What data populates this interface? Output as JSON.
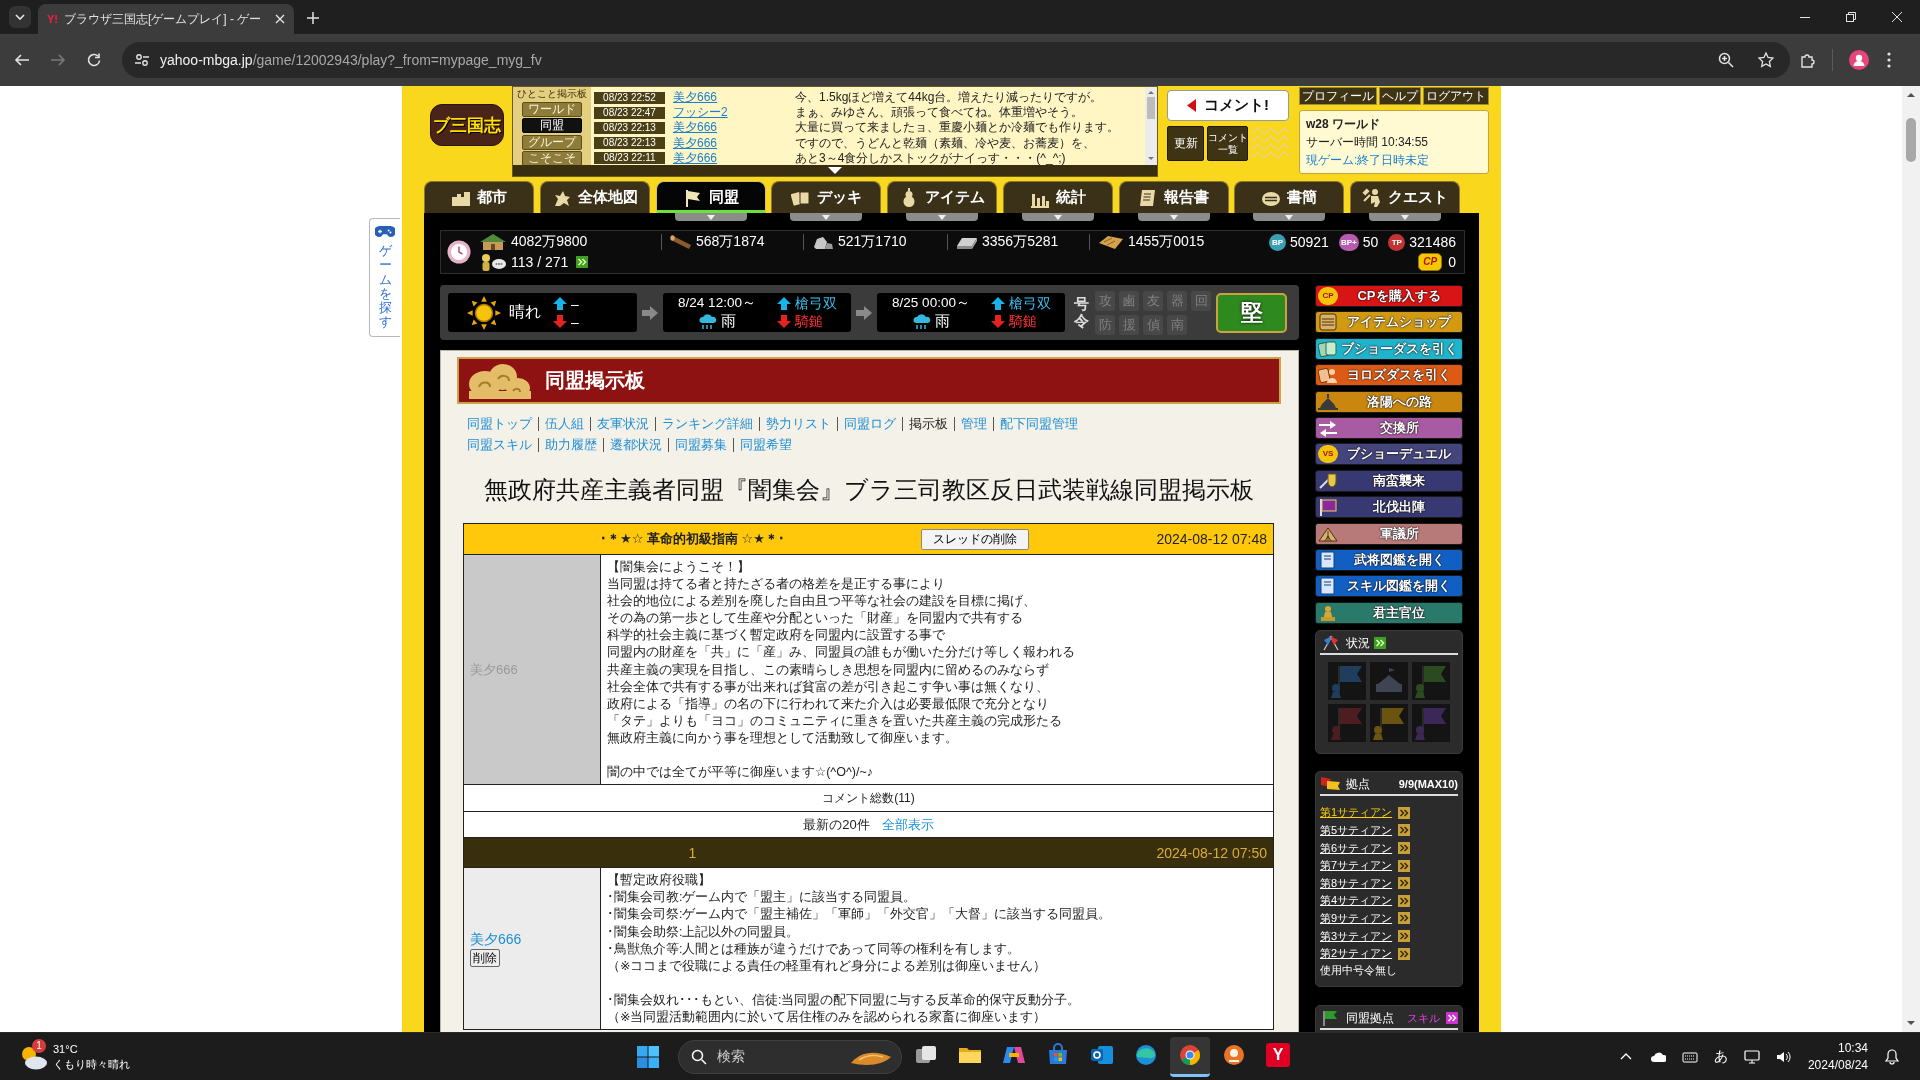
{
  "browser": {
    "tab_favicon": "Y!",
    "tab_title": "ブラウザ三国志[ゲームプレイ] - ゲー",
    "url_host": "yahoo-mbga.jp",
    "url_path": "/game/12002943/play?_from=mypage_myg_fv"
  },
  "side_tab": {
    "label": "ゲームを探す"
  },
  "logo": {
    "text": "ブ三国志"
  },
  "board_feed": {
    "title": "ひとこと掲示板",
    "channels": [
      {
        "label": "ワールド",
        "selected": false
      },
      {
        "label": "同盟",
        "selected": true
      },
      {
        "label": "グループ",
        "selected": false
      },
      {
        "label": "こそこそ",
        "selected": false
      }
    ],
    "posts": [
      {
        "time": "08/23 22:52",
        "author": "美夕666",
        "message": "今、1.5kgほど増えて44kg台。増えたり減ったりですが。"
      },
      {
        "time": "08/23 22:47",
        "author": "フッシー2",
        "message": "まぁ、みゆさん、頑張って食べてね。体重増やそう。"
      },
      {
        "time": "08/23 22:13",
        "author": "美夕666",
        "message": "大量に買って来ましたョ、重慶小麺とか冷麺でも作ります。"
      },
      {
        "time": "08/23 22:13",
        "author": "美夕666",
        "message": "ですので、うどんと乾麺（素麺、冷や麦、お蕎麦）を、"
      },
      {
        "time": "08/23 22:11",
        "author": "美夕666",
        "message": "あと3～4食分しかストックがナイっす・・・(^_^;)"
      }
    ]
  },
  "comment_panel": {
    "comment_button": "コメント!",
    "refresh_button": "更新",
    "list_button": "コメント一覧"
  },
  "account_links": [
    "プロフィール",
    "ヘルプ",
    "ログアウト"
  ],
  "world_info": {
    "world": "w28 ワールド",
    "server_time": "サーバー時間 10:34:55",
    "game_status": "現ゲーム:終了日時未定"
  },
  "nav_tabs": [
    {
      "label": "都市",
      "selected": false,
      "dropdown": false
    },
    {
      "label": "全体地図",
      "selected": false,
      "dropdown": false
    },
    {
      "label": "同盟",
      "selected": true,
      "dropdown": true
    },
    {
      "label": "デッキ",
      "selected": false,
      "dropdown": true
    },
    {
      "label": "アイテム",
      "selected": false,
      "dropdown": true
    },
    {
      "label": "統計",
      "selected": false,
      "dropdown": true
    },
    {
      "label": "報告書",
      "selected": false,
      "dropdown": true
    },
    {
      "label": "書簡",
      "selected": false,
      "dropdown": true
    },
    {
      "label": "クエスト",
      "selected": false,
      "dropdown": true
    }
  ],
  "resources": {
    "assets": "4082万9800",
    "population": "113 / 271",
    "wood": "568万1874",
    "stone": "521万1710",
    "iron": "3356万5281",
    "grain": "1455万0015",
    "points": [
      {
        "badge": "BP",
        "color": "#3a9fb5",
        "value": "50921"
      },
      {
        "badge": "BP+",
        "color": "#b65cb0",
        "value": "50"
      },
      {
        "badge": "TP",
        "color": "#c23434",
        "value": "321486"
      }
    ],
    "cp": {
      "badge": "CP",
      "value": "0"
    }
  },
  "weather_bar": {
    "current": {
      "kind": "sunny",
      "label": "晴れ",
      "up": "–",
      "down": "–"
    },
    "forecasts": [
      {
        "kind": "rain",
        "time": "8/24 12:00～",
        "label": "雨",
        "up": "槍弓双",
        "down": "騎鎚"
      },
      {
        "kind": "rain",
        "time": "8/25 00:00～",
        "label": "雨",
        "up": "槍弓双",
        "down": "騎鎚"
      }
    ],
    "orders_label": "号令",
    "orders": [
      {
        "label": "攻",
        "disabled": true
      },
      {
        "label": "鹵",
        "disabled": true
      },
      {
        "label": "友",
        "disabled": true
      },
      {
        "label": "器",
        "disabled": true
      },
      {
        "label": "回",
        "disabled": true
      },
      {
        "label": "防",
        "disabled": true
      },
      {
        "label": "援",
        "disabled": true
      },
      {
        "label": "偵",
        "disabled": true
      },
      {
        "label": "南",
        "disabled": true
      }
    ],
    "stance_button": "堅"
  },
  "sidebar_buttons": [
    {
      "label": "CPを購入する",
      "color": "#d81414",
      "badge": "CP"
    },
    {
      "label": "アイテムショップ",
      "color": "#d29a12"
    },
    {
      "label": "ブショーダスを引く",
      "color": "#1fb3cc"
    },
    {
      "label": "ヨロズダスを引く",
      "color": "#dc5a14"
    },
    {
      "label": "洛陽への路",
      "color": "#c9870f"
    },
    {
      "label": "交換所",
      "color": "#a85aa2"
    },
    {
      "label": "ブショーデュエル",
      "color": "#45457e",
      "badge": "VS"
    },
    {
      "label": "南蛮襲来",
      "color": "#383872"
    },
    {
      "label": "北伐出陣",
      "color": "#383872"
    },
    {
      "label": "軍議所",
      "color": "#b77a78"
    },
    {
      "label": "武将図鑑を開く",
      "color": "#125fc4"
    },
    {
      "label": "スキル図鑑を開く",
      "color": "#125fc4"
    },
    {
      "label": "君主官位",
      "color": "#2a7a6c"
    }
  ],
  "status_panel": {
    "title": "状況",
    "tiles": [
      {
        "kind": "flag",
        "color": "#1f3d5c"
      },
      {
        "kind": "castle",
        "color": "#3e4452"
      },
      {
        "kind": "flag",
        "color": "#2b4a20"
      },
      {
        "kind": "flag",
        "color": "#4d1d22"
      },
      {
        "kind": "flag",
        "color": "#6a5410"
      },
      {
        "kind": "flag",
        "color": "#3b2858"
      }
    ]
  },
  "bases_panel": {
    "title": "拠点",
    "count": "9/9(MAX10)",
    "bases": [
      {
        "label": "第1サティアン",
        "selected": true
      },
      {
        "label": "第5サティアン",
        "selected": false
      },
      {
        "label": "第6サティアン",
        "selected": false
      },
      {
        "label": "第7サティアン",
        "selected": false
      },
      {
        "label": "第8サティアン",
        "selected": false
      },
      {
        "label": "第4サティアン",
        "selected": false
      },
      {
        "label": "第9サティアン",
        "selected": false
      },
      {
        "label": "第3サティアン",
        "selected": false
      },
      {
        "label": "第2サティアン",
        "selected": false
      }
    ],
    "note": "使用中号令無し"
  },
  "alliance_bases_panel": {
    "title": "同盟拠点",
    "skill_link": "スキル"
  },
  "board": {
    "heading": "同盟掲示板",
    "link_rows": [
      [
        {
          "label": "同盟トップ",
          "selected": false
        },
        {
          "label": "伍人組",
          "selected": false
        },
        {
          "label": "友軍状況",
          "selected": false
        },
        {
          "label": "ランキング詳細",
          "selected": false
        },
        {
          "label": "勢力リスト",
          "selected": false
        },
        {
          "label": "同盟ログ",
          "selected": false
        },
        {
          "label": "掲示板",
          "selected": true
        },
        {
          "label": "管理",
          "selected": false
        },
        {
          "label": "配下同盟管理",
          "selected": false
        }
      ],
      [
        {
          "label": "同盟スキル",
          "selected": false
        },
        {
          "label": "助力履歴",
          "selected": false
        },
        {
          "label": "遷都状況",
          "selected": false
        },
        {
          "label": "同盟募集",
          "selected": false
        },
        {
          "label": "同盟希望",
          "selected": false
        }
      ]
    ],
    "title": "無政府共産主義者同盟『闇集会』ブラ三司教区反日武装戦線同盟掲示板",
    "thread": {
      "title": "･＊★☆ 革命的初級指南 ☆★＊･",
      "delete_button": "スレッドの削除",
      "date": "2024-08-12 07:48",
      "author": "美夕666",
      "body": [
        [
          "【闇集会にようこそ！】",
          "当同盟は持てる者と持たざる者の格差を是正する事により",
          "社会的地位による差別を廃した自由且つ平等な社会の建設を目標に掲げ、",
          "その為の第一歩として生産や分配といった「財産」を同盟内で共有する",
          "科学的社会主義に基づく暫定政府を同盟内に設置する事で",
          "同盟内の財産を「共」に「産」み、同盟員の誰もが働いた分だけ等しく報われる",
          "共産主義の実現を目指し、この素晴らしき思想を同盟内に留めるのみならず",
          "社会全体で共有する事が出来れば貧富の差が引き起こす争い事は無くなり、",
          "政府による「指導」の名の下に行われて来た介入は必要最低限で充分となり",
          "「タテ」よりも「ヨコ」のコミュニティに重きを置いた共産主義の完成形たる",
          "無政府主義に向かう事を理想として活動致して御座います。"
        ],
        [
          "闇の中では全てが平等に御座います☆(^O^)/~♪"
        ]
      ]
    },
    "comment_total": "コメント総数(11)",
    "latest_label": "最新の20件",
    "show_all_link": "全部表示",
    "comments": [
      {
        "number": "1",
        "date": "2024-08-12 07:50",
        "author": "美夕666",
        "delete_button": "削除",
        "body": [
          [
            "【暫定政府役職】",
            "･闇集会司教:ゲーム内で「盟主」に該当する同盟員。",
            "･闇集会司祭:ゲーム内で「盟主補佐」「軍師」「外交官」「大督」に該当する同盟員。",
            "･闇集会助祭:上記以外の同盟員。",
            "･鳥獣魚介等:人間とは種族が違うだけであって同等の権利を有します。",
            "（※ココまで役職による責任の軽重有れど身分による差別は御座いません）"
          ],
          [
            "･闇集会奴れ･･･もとい、信徒:当同盟の配下同盟に与する反革命的保守反動分子。",
            "（※当同盟活動範囲内に於いて居住権のみを認められる家畜に御座います）"
          ]
        ]
      }
    ]
  },
  "taskbar": {
    "weather": {
      "temp": "31°C",
      "text": "くもり時々晴れ",
      "badge": "1"
    },
    "search_placeholder": "検索",
    "apps": [
      {
        "selected": false
      },
      {
        "selected": false
      },
      {
        "selected": false
      },
      {
        "selected": false
      },
      {
        "selected": false
      },
      {
        "selected": false
      },
      {
        "selected": true
      },
      {
        "selected": false
      },
      {
        "selected": false,
        "glyph": "Y"
      }
    ],
    "ime": "あ",
    "time": "10:34",
    "date": "2024/08/24"
  }
}
